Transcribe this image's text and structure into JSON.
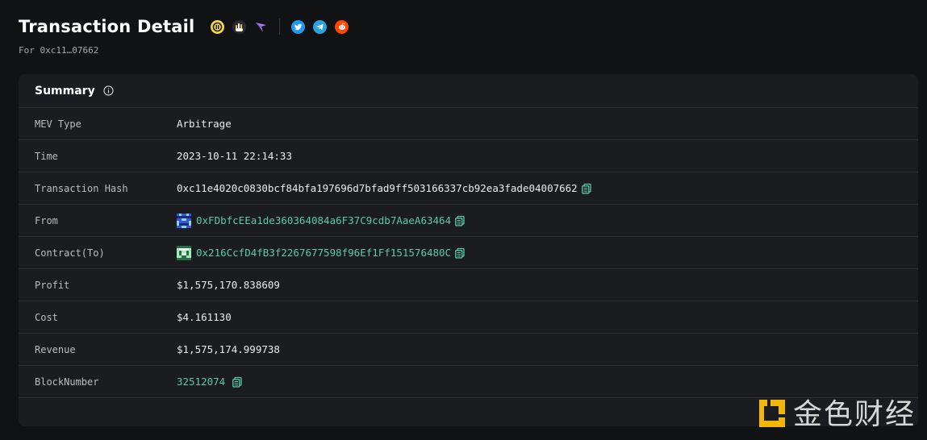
{
  "header": {
    "title": "Transaction Detail",
    "subtitle": "For 0xc11…07662",
    "badges": [
      "explorer-icon",
      "hand-icon",
      "arrow-icon"
    ],
    "social": [
      "twitter-icon",
      "telegram-icon",
      "reddit-icon"
    ]
  },
  "summary": {
    "title": "Summary",
    "rows": [
      {
        "label": "MEV Type",
        "value": "Arbitrage"
      },
      {
        "label": "Time",
        "value": "2023-10-11 22:14:33"
      },
      {
        "label": "Transaction Hash",
        "value": "0xc11e4020c0830bcf84bfa197696d7bfad9ff503166337cb92ea3fade04007662"
      },
      {
        "label": "From",
        "value": "0xFDbfcEEa1de360364084a6F37C9cdb7AaeA63464"
      },
      {
        "label": "Contract(To)",
        "value": "0x216CcfD4fB3f2267677598f96Ef1Ff151576480C"
      },
      {
        "label": "Profit",
        "value": "$1,575,170.838609"
      },
      {
        "label": "Cost",
        "value": "$4.161130"
      },
      {
        "label": "Revenue",
        "value": "$1,575,174.999738"
      },
      {
        "label": "BlockNumber",
        "value": "32512074"
      }
    ]
  },
  "watermark": {
    "text": "金色财经"
  },
  "colors": {
    "accent": "#5cc9a7",
    "background": "#111214",
    "card": "#1b1c1f"
  }
}
